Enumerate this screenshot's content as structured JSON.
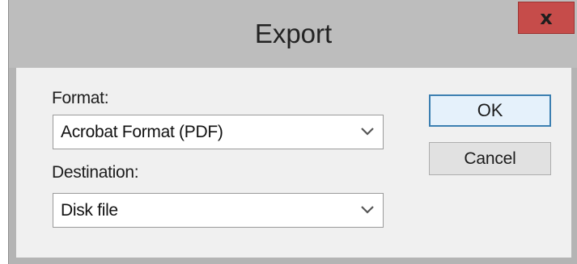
{
  "dialog": {
    "title": "Export",
    "close_label": "x"
  },
  "format": {
    "label": "Format:",
    "selected": "Acrobat Format (PDF)"
  },
  "destination": {
    "label": "Destination:",
    "selected": "Disk file"
  },
  "buttons": {
    "ok_label": "OK",
    "cancel_label": "Cancel"
  },
  "colors": {
    "close_button": "#c64c4a",
    "ok_border": "#3c7fb1",
    "dialog_frame": "#bdbdbd",
    "client_bg": "#f0f0f0"
  },
  "icons": {
    "close": "close-icon",
    "dropdown": "chevron-down-icon"
  }
}
